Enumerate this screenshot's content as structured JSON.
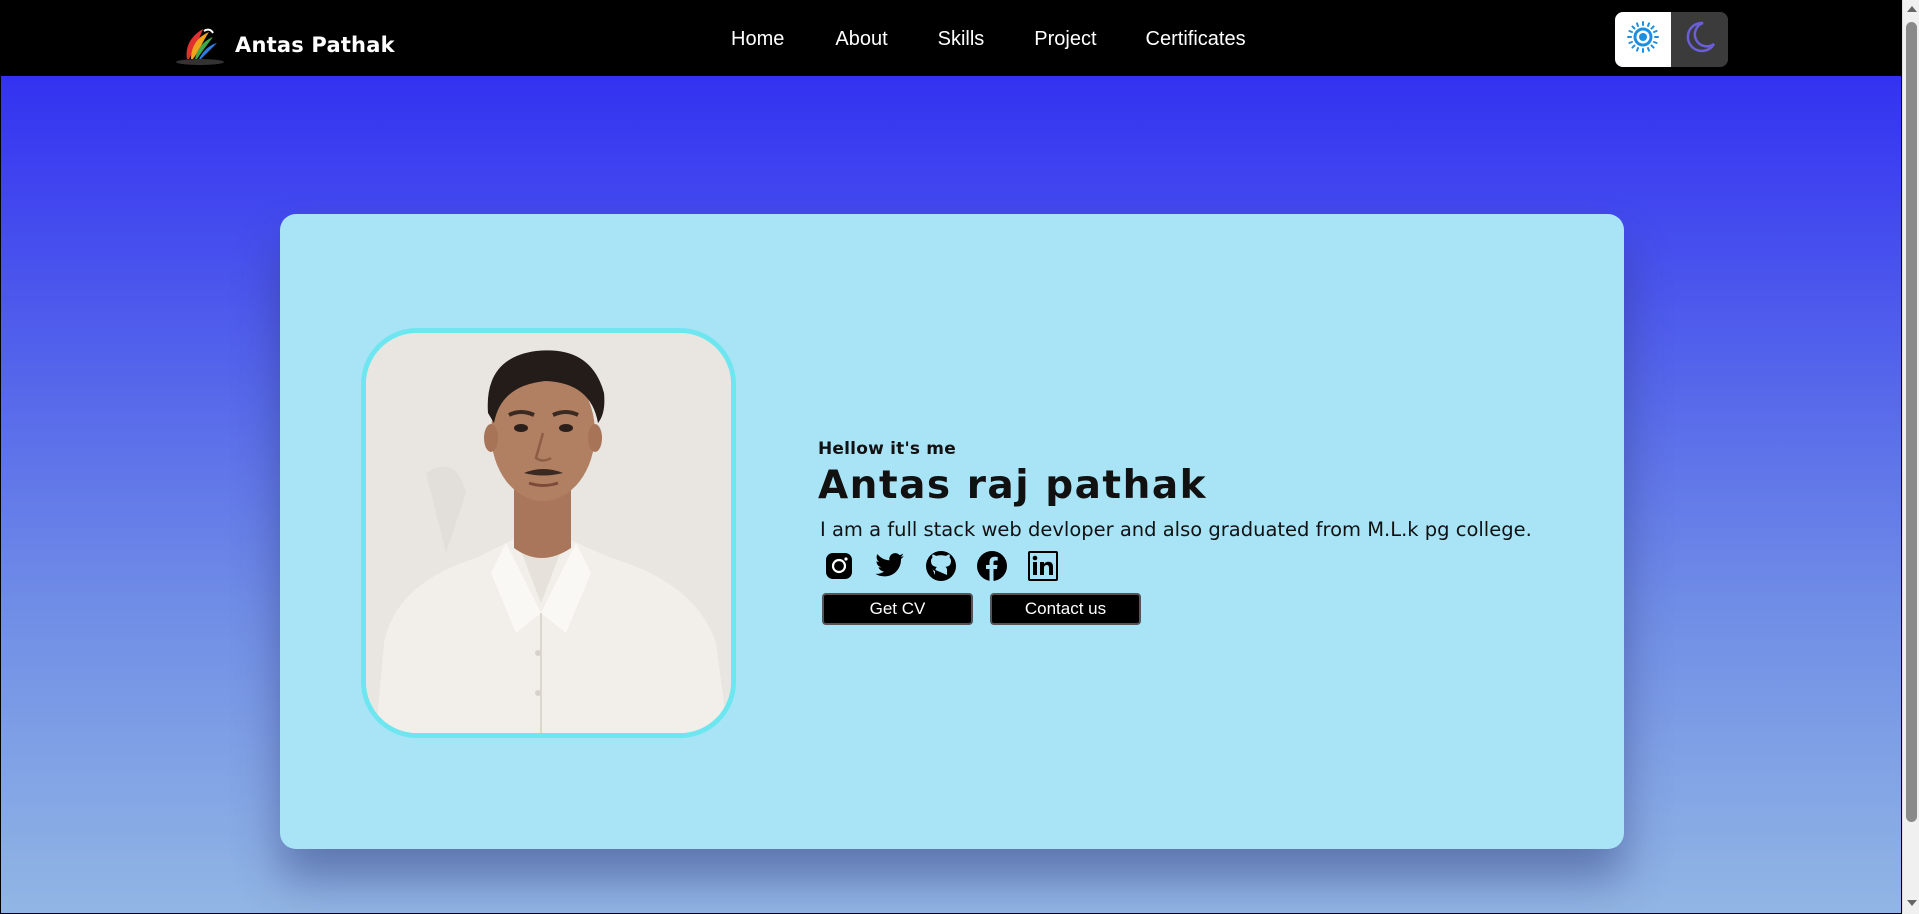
{
  "brand": {
    "name": "Antas Pathak",
    "logo_icon": "feather-quill-logo-icon"
  },
  "nav": {
    "links": [
      "Home",
      "About",
      "Skills",
      "Project",
      "Certificates"
    ]
  },
  "theme_toggle": {
    "light_icon": "sun-icon",
    "dark_icon": "moon-icon",
    "selected": "light"
  },
  "hero": {
    "greeting": "Hellow it's me",
    "name": "Antas raj pathak",
    "description": "I am a full stack web devloper and also graduated from M.L.k pg college.",
    "photo": "profile-photo",
    "socials": [
      "instagram-icon",
      "twitter-icon",
      "github-icon",
      "facebook-icon",
      "linkedin-icon"
    ],
    "buttons": {
      "cv": "Get CV",
      "contact": "Contact us"
    }
  },
  "colors": {
    "navbar": "#000000",
    "background_top": "#2a25f2",
    "background_bottom": "#92b6e4",
    "card": "#a9e4f6",
    "photo_border": "#6ee6f0",
    "sun": "#1e8fe0",
    "moon": "#6a5fd6"
  }
}
